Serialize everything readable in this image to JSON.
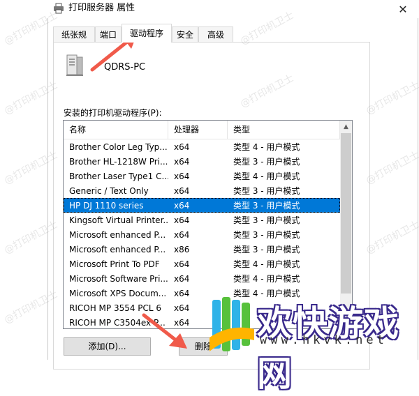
{
  "window": {
    "title": "打印服务器 属性",
    "close_glyph": "✕",
    "icon": "printer-icon"
  },
  "tabs": [
    {
      "label": "纸张规格",
      "active": false
    },
    {
      "label": "端口",
      "active": false
    },
    {
      "label": "驱动程序",
      "active": true
    },
    {
      "label": "安全",
      "active": false
    },
    {
      "label": "高级",
      "active": false
    }
  ],
  "server": {
    "name": "QDRS-PC",
    "icon": "printer-tower-icon"
  },
  "drivers_label": "安装的打印机驱动程序(P):",
  "columns": [
    "名称",
    "处理器",
    "类型"
  ],
  "drivers": [
    {
      "name": "Brother Color Leg Typ...",
      "proc": "x64",
      "type": "类型 4 - 用户模式"
    },
    {
      "name": "Brother HL-1218W Pri...",
      "proc": "x64",
      "type": "类型 3 - 用户模式"
    },
    {
      "name": "Brother Laser Type1 C...",
      "proc": "x64",
      "type": "类型 4 - 用户模式"
    },
    {
      "name": "Generic / Text Only",
      "proc": "x64",
      "type": "类型 3 - 用户模式"
    },
    {
      "name": "HP DJ 1110 series",
      "proc": "x64",
      "type": "类型 3 - 用户模式",
      "selected": true
    },
    {
      "name": "Kingsoft Virtual Printer...",
      "proc": "x64",
      "type": "类型 3 - 用户模式"
    },
    {
      "name": "Microsoft enhanced P...",
      "proc": "x64",
      "type": "类型 3 - 用户模式"
    },
    {
      "name": "Microsoft enhanced P...",
      "proc": "x86",
      "type": "类型 3 - 用户模式"
    },
    {
      "name": "Microsoft Print To PDF",
      "proc": "x64",
      "type": "类型 4 - 用户模式"
    },
    {
      "name": "Microsoft Software Pri...",
      "proc": "x64",
      "type": "类型 4 - 用户模式"
    },
    {
      "name": "Microsoft XPS Docum...",
      "proc": "x64",
      "type": "类型 4 - 用户模式"
    },
    {
      "name": "RICOH MP 3554 PCL 6",
      "proc": "x64",
      "type": ""
    },
    {
      "name": "RICOH MP C3504ex P...",
      "proc": "x64",
      "type": ""
    }
  ],
  "buttons": {
    "add": "添加(D)...",
    "remove": "删除"
  },
  "watermark": "@打印机卫士",
  "logo": {
    "title": "欢快游戏网",
    "url": "www.hkvk.net"
  },
  "colors": {
    "selection": "#0078d7",
    "arrow": "#f05a4a"
  }
}
